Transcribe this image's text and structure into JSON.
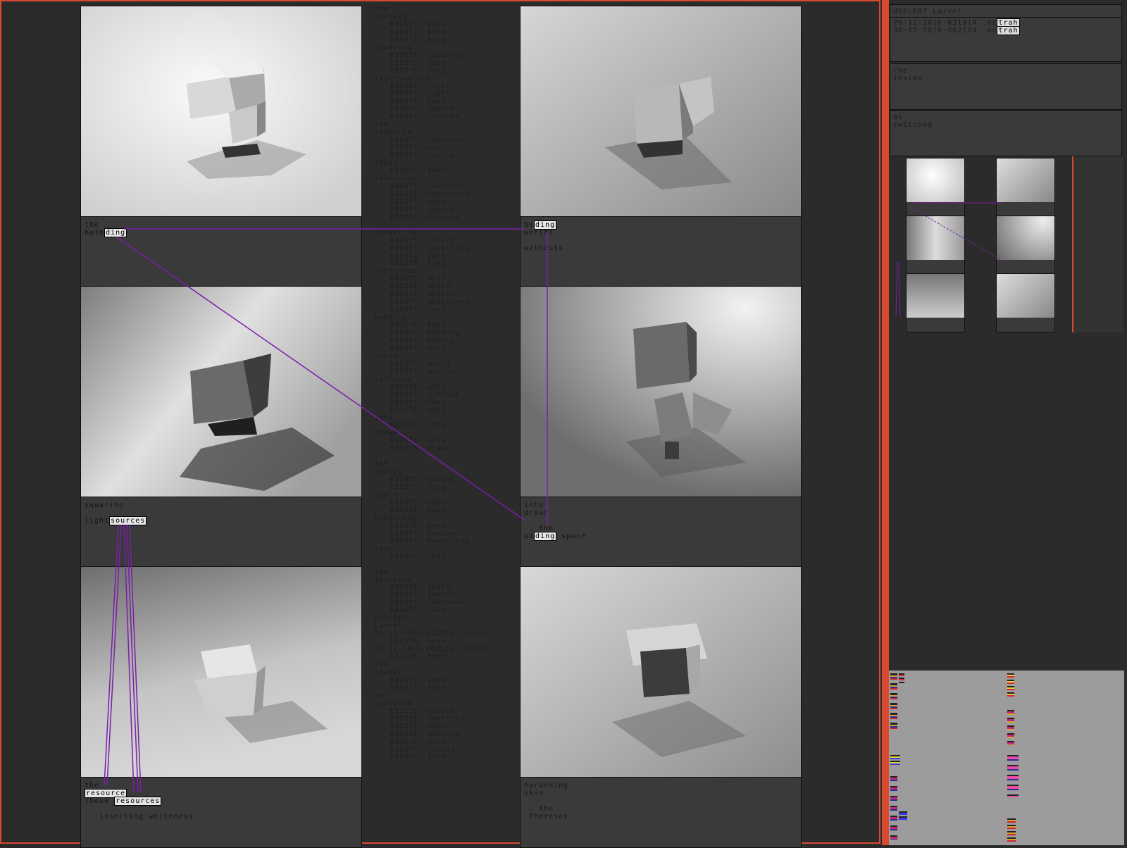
{
  "panels": [
    {
      "caption_lines": [
        "the",
        "bath"
      ],
      "highlight": "ding",
      "hl_line": 1
    },
    {
      "caption_lines": [
        "be",
        "worlds",
        "",
        "withouts"
      ],
      "highlight": "ding",
      "hl_line": 0
    },
    {
      "caption_lines": [
        "squaring",
        "",
        "light"
      ],
      "highlight": "sources",
      "hl_line": 2
    },
    {
      "caption_lines": [
        "into",
        "drawn",
        "",
        ". the",
        "ad"
      ],
      "highlight": "ding",
      "hl_line": 4,
      "hl_after": " space"
    },
    {
      "caption_lines": [
        "the",
        "",
        "these "
      ],
      "highlight_list": [
        "resource",
        "resources"
      ],
      "extra": ". inserting whiteness"
    },
    {
      "caption_lines": [
        "hardening",
        "skin",
        "",
        ". the",
        "thereses"
      ]
    }
  ],
  "captions": {
    "p1_l1": "the",
    "p1_l2a": "bath",
    "p1_l2b": "ding",
    "p2_l1a": "be",
    "p2_l1b": "ding",
    "p2_l2": "worlds",
    "p2_l4": "withouts",
    "p3_l1": "squaring",
    "p3_l3a": "light",
    "p3_l3b": "sources",
    "p4_l1": "into",
    "p4_l2": "drawn",
    "p4_l4": ". the",
    "p4_l5a": "ad",
    "p4_l5b": "ding",
    "p4_l5c": " space",
    "p5_l1": "the",
    "p5_l2": "resource",
    "p5_l3a": "these ",
    "p5_l3b": "resources",
    "p5_l5": ". inserting whiteness",
    "p6_l1": "hardening",
    "p6_l2": "skin",
    "p6_l4": ". the",
    "p6_l5": "thereses"
  },
  "log": [
    [
      "the",
      0
    ],
    [
      "bathing",
      0
    ],
    [
      "EXISTS  bath",
      1
    ],
    [
      "EXISTS  bind",
      1
    ],
    [
      "EXISTS  bing",
      1
    ],
    [
      "squaring",
      0
    ],
    [
      "EXISTS  squaring",
      1
    ],
    [
      "EXISTS  quan",
      1
    ],
    [
      "EXISTS  ring",
      1
    ],
    [
      "lightsources",
      0
    ],
    [
      "EXISTS  light",
      1
    ],
    [
      "EXISTS  lights",
      1
    ],
    [
      "EXISTS  sour",
      1
    ],
    [
      "EXISTS  source",
      1
    ],
    [
      "EXISTS  sources",
      1
    ],
    [
      "the",
      0
    ],
    [
      "resource",
      0
    ],
    [
      "EXISTS  resource",
      1
    ],
    [
      "EXISTS  sour",
      1
    ],
    [
      "EXISTS  source",
      1
    ],
    [
      "these",
      0
    ],
    [
      "EXISTS  these",
      1
    ],
    [
      "resources",
      0
    ],
    [
      "EXISTS  resource",
      1
    ],
    [
      "EXISTS  resources",
      1
    ],
    [
      "EXISTS  sour",
      1
    ],
    [
      "EXISTS  source",
      1
    ],
    [
      "EXISTS  sources",
      1
    ],
    [
      ".",
      0
    ],
    [
      "inserting",
      0
    ],
    [
      "EXISTS  insert",
      1
    ],
    [
      "EXISTS  inserting",
      1
    ],
    [
      "EXISTS  sert",
      1
    ],
    [
      "EXISTS  ting",
      1
    ],
    [
      "whiteness",
      0
    ],
    [
      "EXISTS  whit",
      1
    ],
    [
      "EXISTS  white",
      1
    ],
    [
      "EXISTS  whiten",
      1
    ],
    [
      "EXISTS  whiteness",
      1
    ],
    [
      "EXISTS  ness",
      1
    ],
    [
      "bending",
      0
    ],
    [
      "EXISTS  bend",
      1
    ],
    [
      "EXISTS  bending",
      1
    ],
    [
      "EXISTS  ending",
      1
    ],
    [
      "EXISTS  ding",
      1
    ],
    [
      "worlds",
      0
    ],
    [
      "EXISTS  world",
      1
    ],
    [
      "EXISTS  worlds",
      1
    ],
    [
      "withouts",
      0
    ],
    [
      "EXISTS  with",
      1
    ],
    [
      "EXISTS  without",
      1
    ],
    [
      "EXISTS  thou",
      1
    ],
    [
      "EXISTS  outs",
      1
    ],
    [
      "into",
      0
    ],
    [
      "EXISTS  into",
      1
    ],
    [
      "drawn",
      0
    ],
    [
      "EXISTS  draw",
      1
    ],
    [
      "EXISTS  drawn",
      1
    ],
    [
      ".",
      0
    ],
    [
      "the",
      0
    ],
    [
      "adding",
      0
    ],
    [
      "EXISTS  adding",
      1
    ],
    [
      "EXISTS  ding",
      1
    ],
    [
      "space",
      0
    ],
    [
      "EXISTS  space",
      1
    ],
    [
      "EXISTS  pace",
      1
    ],
    [
      "hardening",
      0
    ],
    [
      "EXISTS  hard",
      1
    ],
    [
      "EXISTS  harden",
      1
    ],
    [
      "EXISTS  hardening",
      1
    ],
    [
      "skin",
      0
    ],
    [
      "EXISTS  skin",
      1
    ],
    [
      ".",
      0
    ],
    [
      "the",
      0
    ],
    [
      "thereses",
      0
    ],
    [
      "EXISTS  there",
      1
    ],
    [
      "EXISTS  theres",
      1
    ],
    [
      "EXISTS  thereses",
      1
    ],
    [
      "EXISTS  rese",
      1
    ],
    [
      "USELEKT",
      0
    ],
    [
      "Larcel",
      0
    ],
    [
      "26-12-2016-031914 .nctrah",
      0
    ],
    [
      "EXISTS  trah",
      1
    ],
    [
      "30-12-2016-202124 .nctrah",
      0
    ],
    [
      "EXISTS  trah",
      1
    ],
    [
      "the",
      0
    ],
    [
      "inside",
      0
    ],
    [
      "EXISTS  insid",
      1
    ],
    [
      "EXISTS  side",
      1
    ],
    [
      "as",
      0
    ],
    [
      "switched",
      0
    ],
    [
      "EXISTS  switch",
      1
    ],
    [
      "EXISTS  switched",
      1
    ],
    [
      "EXISTS  witch",
      1
    ],
    [
      "EXISTS  witched",
      1
    ],
    [
      "EXISTS  itch",
      1
    ],
    [
      "EXISTS  itched",
      1
    ],
    [
      "EXISTS  tche",
      1
    ]
  ],
  "right_panel": {
    "title": "USELEKT Larcel",
    "entry1_prefix": "26-12-2016-031914 .nc",
    "entry1_hl": "trah",
    "entry2_prefix": "30-12-2016-202124 .nc",
    "entry2_hl": "trah",
    "box2_line1": "the",
    "box2_line2": "inside",
    "box3_line1": "as",
    "box3_line2": "switched"
  },
  "colors": {
    "frame": "#d84a2f",
    "link": "#7a1fa8",
    "background": "#2b2b2b",
    "caption_bg": "#3a3a3a"
  }
}
